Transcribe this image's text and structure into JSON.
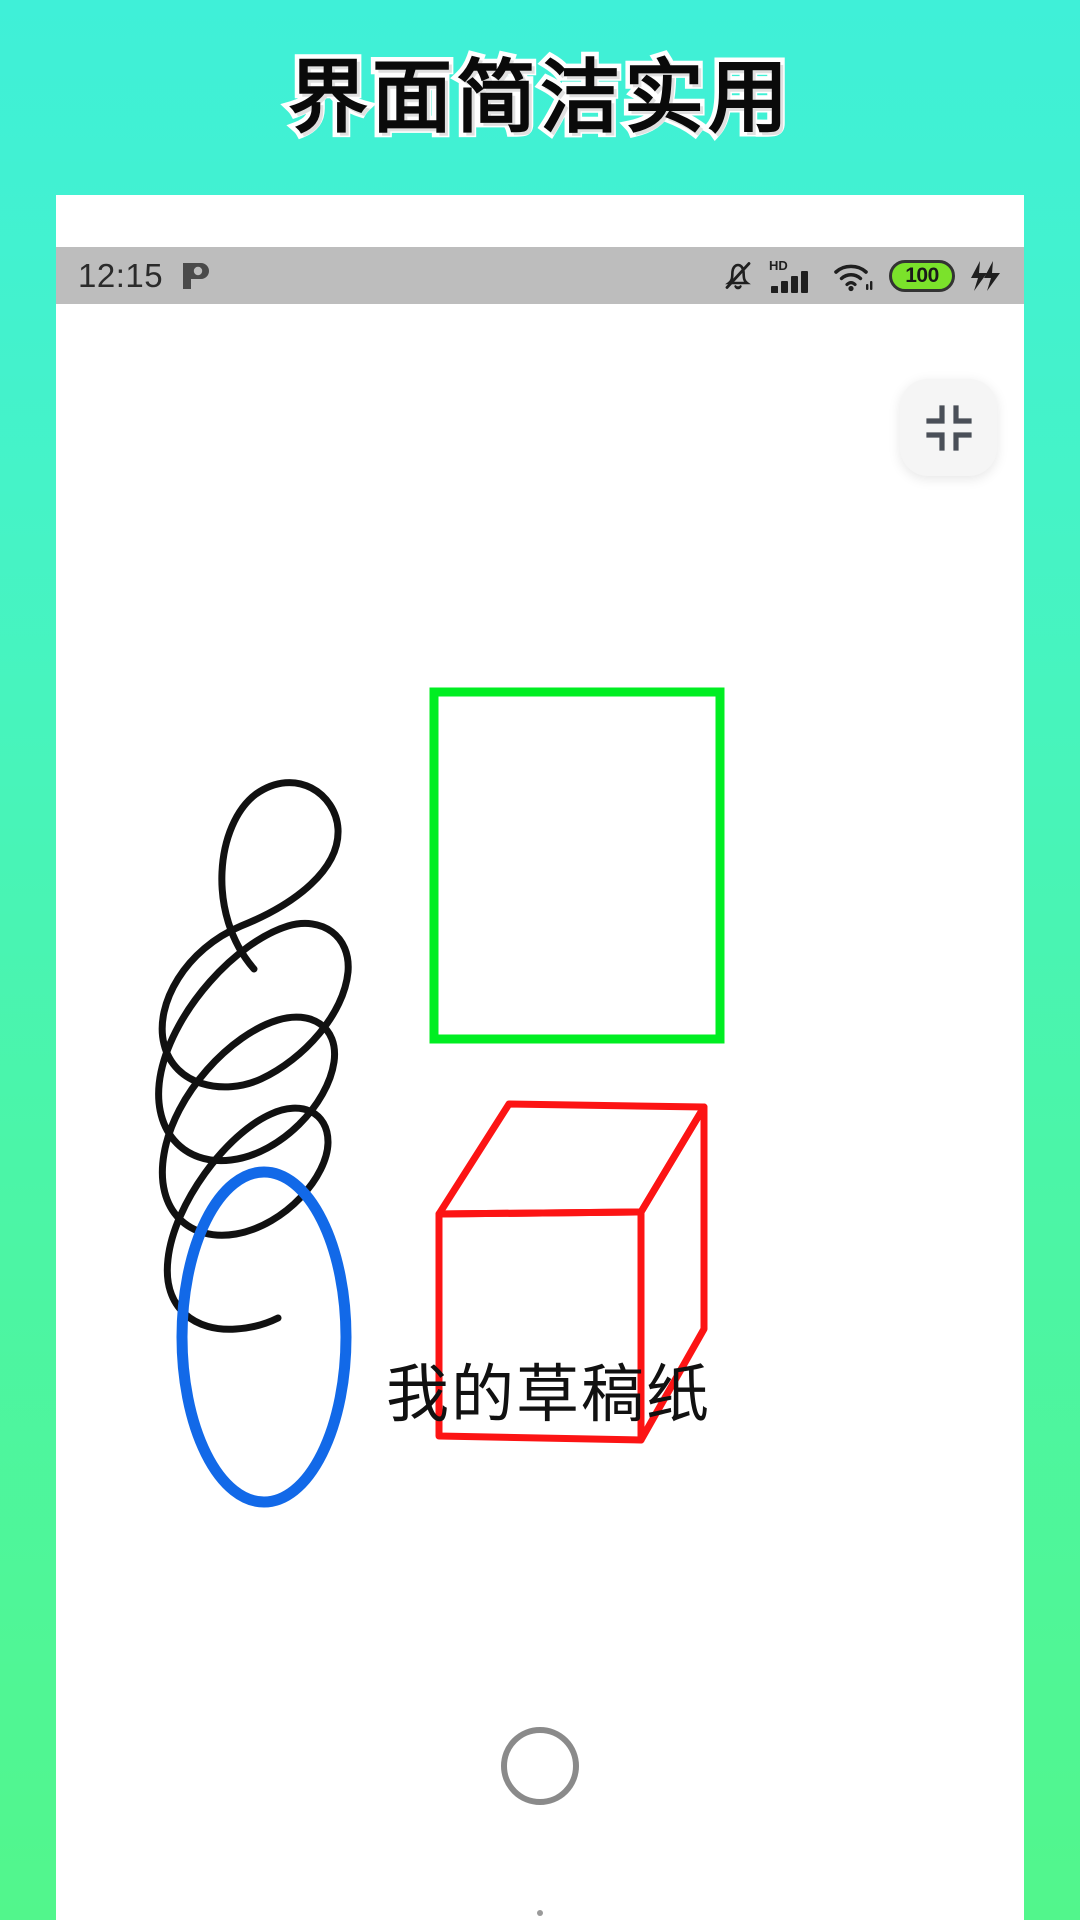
{
  "promo": {
    "title": "界面简洁实用",
    "background_top": "#3FF0D8",
    "background_bottom": "#52F68C"
  },
  "phone": {
    "status_bar": {
      "clock": "12:15",
      "app_icon": "pinduoduo-icon",
      "icons": [
        {
          "name": "bell-muted-icon",
          "label": "静音"
        },
        {
          "name": "hd-signal-icon",
          "label": "HD"
        },
        {
          "name": "wifi-icon",
          "label": "WiFi"
        },
        {
          "name": "battery-icon",
          "label": "100"
        },
        {
          "name": "charging-bolt-icon",
          "label": "充电"
        }
      ],
      "battery_level": "100",
      "battery_color": "#7BE22B",
      "background_color": "#bdbdbd"
    },
    "canvas": {
      "background_color": "#ffffff",
      "label_text": "我的草稿纸",
      "collapse_button": {
        "name": "exit-fullscreen-button",
        "icon": "collapse-corners-icon"
      },
      "drawings": [
        {
          "name": "black-scribble-spiral",
          "color": "#111111",
          "stroke_width": 7
        },
        {
          "name": "green-rectangle",
          "color": "#00EE22",
          "stroke_width": 9
        },
        {
          "name": "blue-ellipse",
          "color": "#1269E8",
          "stroke_width": 11
        },
        {
          "name": "red-cube",
          "color": "#FC1414",
          "stroke_width": 7
        }
      ]
    },
    "home_button": {
      "name": "home-circle-button"
    }
  }
}
